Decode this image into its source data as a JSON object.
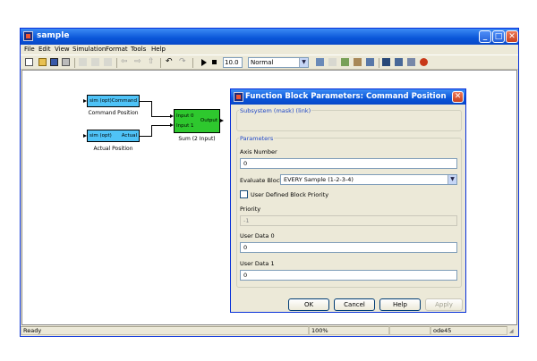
{
  "window": {
    "title": "sample"
  },
  "menu": [
    "File",
    "Edit",
    "View",
    "Simulation",
    "Format",
    "Tools",
    "Help"
  ],
  "toolbar": {
    "sim_time": "10.0",
    "sim_mode": "Normal"
  },
  "canvas": {
    "block1": {
      "in_port": "sim (opt)",
      "out_port": "Command",
      "caption": "Command Position"
    },
    "block2": {
      "in_port": "sim (opt)",
      "out_port": "Actual",
      "caption": "Actual Position"
    },
    "sum": {
      "in0": "Input 0",
      "in1": "Input 1",
      "out": "Output",
      "caption": "Sum (2 Input)"
    }
  },
  "status": {
    "left": "Ready",
    "zoom": "100%",
    "solver": "ode45"
  },
  "dialog": {
    "title": "Function Block Parameters: Command Position",
    "subsystem_label": "Subsystem (mask) (link)",
    "params_label": "Parameters",
    "axis_label": "Axis Number",
    "axis_value": "0",
    "eval_label": "Evaluate Block",
    "eval_value": "EVERY Sample (1-2-3-4)",
    "priority_check_label": "User Defined Block Priority",
    "priority_label": "Priority",
    "priority_value": "-1",
    "ud0_label": "User Data 0",
    "ud0_value": "0",
    "ud1_label": "User Data 1",
    "ud1_value": "0",
    "ok": "OK",
    "cancel": "Cancel",
    "help": "Help",
    "apply": "Apply"
  }
}
